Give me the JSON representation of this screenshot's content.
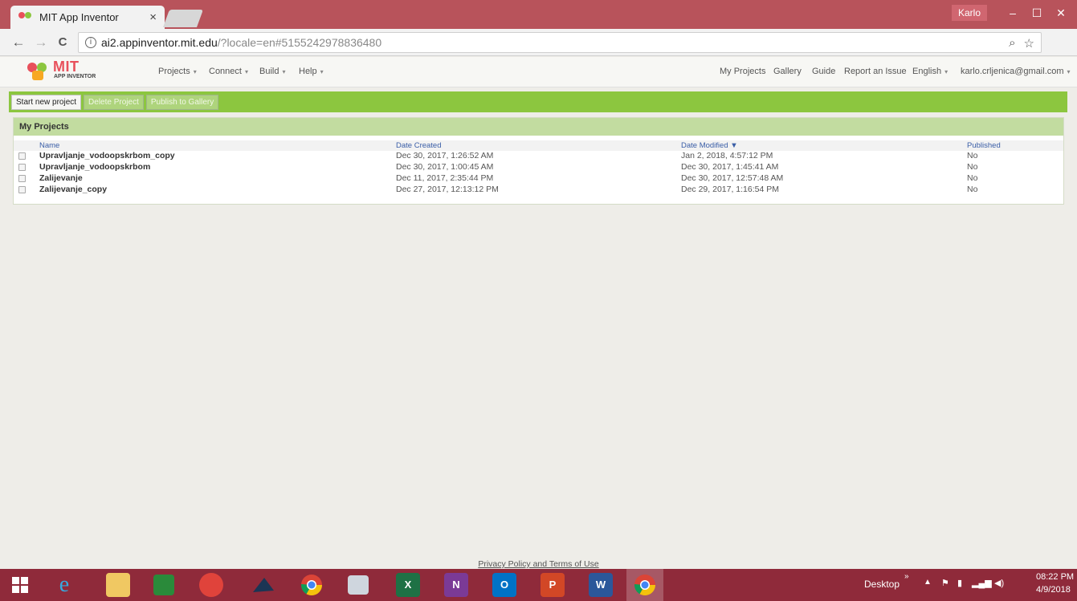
{
  "browser": {
    "tab_title": "MIT App Inventor",
    "tab_close": "×",
    "profile_name": "Karlo",
    "min": "–",
    "max": "☐",
    "close": "✕",
    "back": "←",
    "forward": "→",
    "reload": "C",
    "info": "i",
    "url_host": "ai2.appinventor.mit.edu",
    "url_rest": "/?locale=en#5155242978836480",
    "zoom_icon": "⌕",
    "star_icon": "☆",
    "menu_icon": "⋮"
  },
  "app": {
    "logo_title": "MIT",
    "logo_subtitle": "APP INVENTOR",
    "menus": [
      "Projects",
      "Connect",
      "Build",
      "Help"
    ],
    "caret": "▾",
    "links": {
      "my_projects": "My Projects",
      "gallery": "Gallery",
      "guide": "Guide",
      "report": "Report an Issue",
      "language": "English",
      "account": "karlo.crljenica@gmail.com"
    }
  },
  "toolbar": {
    "start_new": "Start new project",
    "delete": "Delete Project",
    "publish": "Publish to Gallery"
  },
  "projects": {
    "title": "My Projects",
    "columns": {
      "name": "Name",
      "created": "Date Created",
      "modified": "Date Modified ▼",
      "published": "Published"
    },
    "rows": [
      {
        "name": "Upravljanje_vodoopskrbom_copy",
        "created": "Dec 30, 2017, 1:26:52 AM",
        "modified": "Jan 2, 2018, 4:57:12 PM",
        "published": "No"
      },
      {
        "name": "Upravljanje_vodoopskrbom",
        "created": "Dec 30, 2017, 1:00:45 AM",
        "modified": "Dec 30, 2017, 1:45:41 AM",
        "published": "No"
      },
      {
        "name": "Zalijevanje",
        "created": "Dec 11, 2017, 2:35:44 PM",
        "modified": "Dec 30, 2017, 12:57:48 AM",
        "published": "No"
      },
      {
        "name": "Zalijevanje_copy",
        "created": "Dec 27, 2017, 12:13:12 PM",
        "modified": "Dec 29, 2017, 1:16:54 PM",
        "published": "No"
      }
    ]
  },
  "footer": {
    "privacy": "Privacy Policy and Terms of Use"
  },
  "taskbar": {
    "desktop": "Desktop",
    "chevron": "»",
    "time": "08:22 PM",
    "date": "4/9/2018",
    "excel": "X",
    "onenote": "N",
    "outlook": "O",
    "powerpoint": "P",
    "word": "W",
    "ie": "e",
    "colors": {
      "taskbar": "#8f2a3a",
      "excel": "#1e7145",
      "onenote": "#7b3a96",
      "outlook": "#0072c6",
      "powerpoint": "#d24726",
      "word": "#2b579a"
    }
  }
}
